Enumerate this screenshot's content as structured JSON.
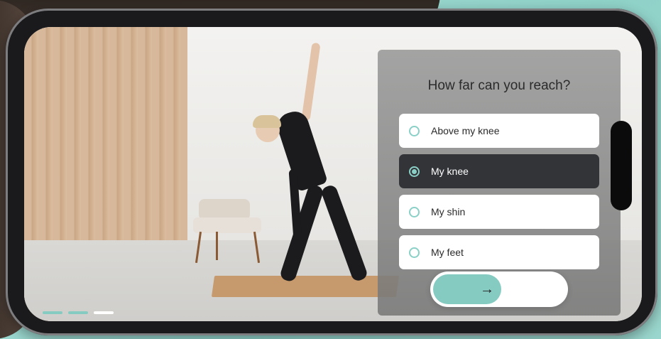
{
  "quiz": {
    "question": "How far can you reach?",
    "options": [
      {
        "label": "Above my knee",
        "selected": false
      },
      {
        "label": "My knee",
        "selected": true
      },
      {
        "label": "My shin",
        "selected": false
      },
      {
        "label": "My feet",
        "selected": false
      }
    ],
    "next_icon": "→"
  },
  "progress": {
    "steps": [
      {
        "state": "completed",
        "color": "#86cbc1"
      },
      {
        "state": "completed",
        "color": "#86cbc1"
      },
      {
        "state": "current",
        "color": "#ffffff"
      }
    ]
  },
  "colors": {
    "accent": "#86cbc1",
    "selected_option_bg": "#333438",
    "background": "#a9ddd6"
  },
  "icons": {
    "radio": "radio-icon",
    "next": "arrow-right-icon"
  }
}
